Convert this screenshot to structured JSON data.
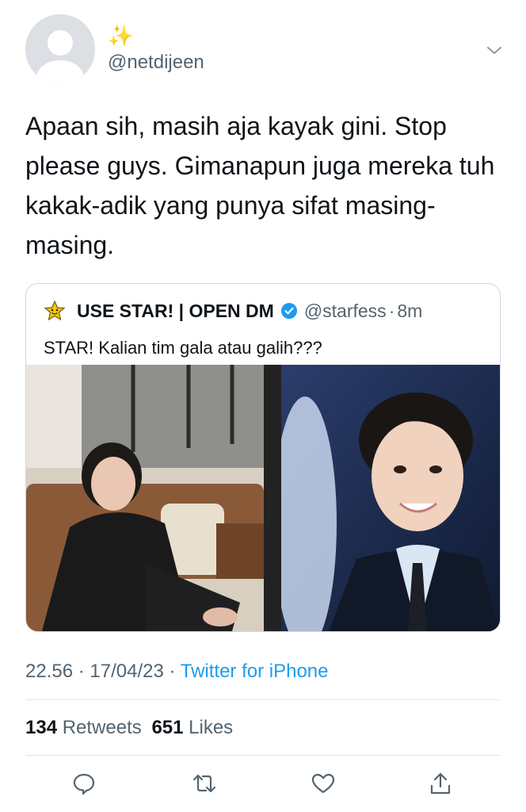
{
  "tweet": {
    "display_name": "✨",
    "handle": "@netdijeen",
    "text": "Apaan sih, masih aja kayak gini. Stop please guys. Gimanapun juga mereka tuh kakak-adik yang punya sifat masing-masing.",
    "time": "22.56",
    "date": "17/04/23",
    "source": "Twitter for iPhone",
    "retweets_count": "134",
    "retweets_label": "Retweets",
    "likes_count": "651",
    "likes_label": "Likes"
  },
  "quote": {
    "name": "USE STAR! | OPEN DM",
    "handle": "@starfess",
    "separator": "·",
    "age": "8m",
    "text": "STAR! Kalian tim gala atau galih???"
  },
  "icons": {
    "avatar": "default-avatar-icon",
    "menu": "chevron-down-icon",
    "quote_avatar": "star-icon",
    "verified": "verified-badge-icon",
    "reply": "reply-icon",
    "retweet": "retweet-icon",
    "like": "heart-icon",
    "share": "share-icon"
  },
  "colors": {
    "link": "#1d9bf0",
    "secondary_text": "#536471",
    "sparkle": "#f2c230"
  }
}
